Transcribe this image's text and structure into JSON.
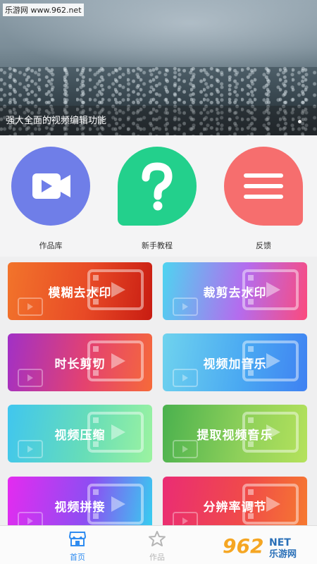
{
  "banner": {
    "watermark": "乐游网 www.962.net",
    "caption": "强大全面的视频编辑功能"
  },
  "features": [
    {
      "label": "作品库",
      "icon": "video-camera-icon",
      "color": "#6f7ee8"
    },
    {
      "label": "新手教程",
      "icon": "question-mark-icon",
      "color": "#23d08c"
    },
    {
      "label": "反馈",
      "icon": "menu-lines-icon",
      "color": "#f66e6e"
    }
  ],
  "tools": [
    {
      "label": "模糊去水印"
    },
    {
      "label": "裁剪去水印"
    },
    {
      "label": "时长剪切"
    },
    {
      "label": "视频加音乐"
    },
    {
      "label": "视频压缩"
    },
    {
      "label": "提取视频音乐"
    },
    {
      "label": "视频拼接"
    },
    {
      "label": "分辨率调节"
    }
  ],
  "bottom_nav": {
    "home_label": "首页",
    "works_label": "作品",
    "active_color": "#2f8cf0",
    "brand_text_1": "962",
    "brand_text_2": "NET",
    "brand_text_3": "乐游网"
  }
}
